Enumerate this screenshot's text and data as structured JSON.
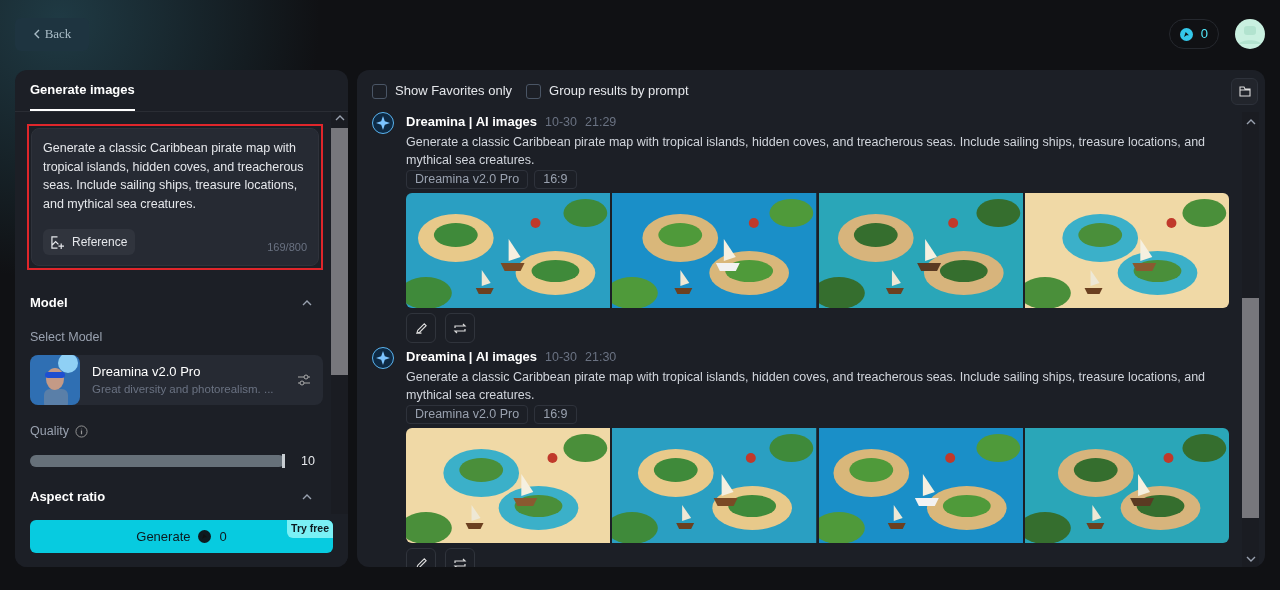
{
  "back_button": {
    "label": "Back"
  },
  "credits": {
    "value": "0"
  },
  "left_panel": {
    "tabs": [
      {
        "label": "Generate images",
        "selected": true
      }
    ],
    "prompt": {
      "value": "Generate a classic Caribbean pirate map with tropical islands, hidden coves, and treacherous seas. Include sailing ships, treasure locations, and mythical sea creatures.",
      "highlighted": true,
      "reference_button": "Reference",
      "counter": "169/800"
    },
    "model_section": {
      "title": "Model",
      "expanded": true,
      "select_label": "Select Model",
      "model": {
        "name": "Dreamina v2.0 Pro",
        "description": "Great diversity and photorealism. ..."
      }
    },
    "quality": {
      "label": "Quality",
      "level": 1.0,
      "reading": "10"
    },
    "aspect_ratio": {
      "title": "Aspect ratio",
      "expanded": true
    },
    "generate_button": {
      "label": "Generate",
      "cost": "0",
      "badge": "Try free"
    }
  },
  "results": {
    "filters": [
      {
        "label": "Show Favorites only",
        "checked": false
      },
      {
        "label": "Group results by prompt",
        "checked": false
      }
    ],
    "items": [
      {
        "author": "Dreamina | AI images",
        "date": "10-30",
        "time": "21:29",
        "prompt": "Generate a classic Caribbean pirate map with tropical islands, hidden coves, and treacherous seas. Include sailing ships, treasure locations, and mythical sea creatures.",
        "model_tag": "Dreamina v2.0 Pro",
        "ratio_tag": "16:9"
      },
      {
        "author": "Dreamina | AI images",
        "date": "10-30",
        "time": "21:30",
        "prompt": "Generate a classic Caribbean pirate map with tropical islands, hidden coves, and treacherous seas. Include sailing ships, treasure locations, and mythical sea creatures.",
        "model_tag": "Dreamina v2.0 Pro",
        "ratio_tag": "16:9"
      }
    ]
  }
}
